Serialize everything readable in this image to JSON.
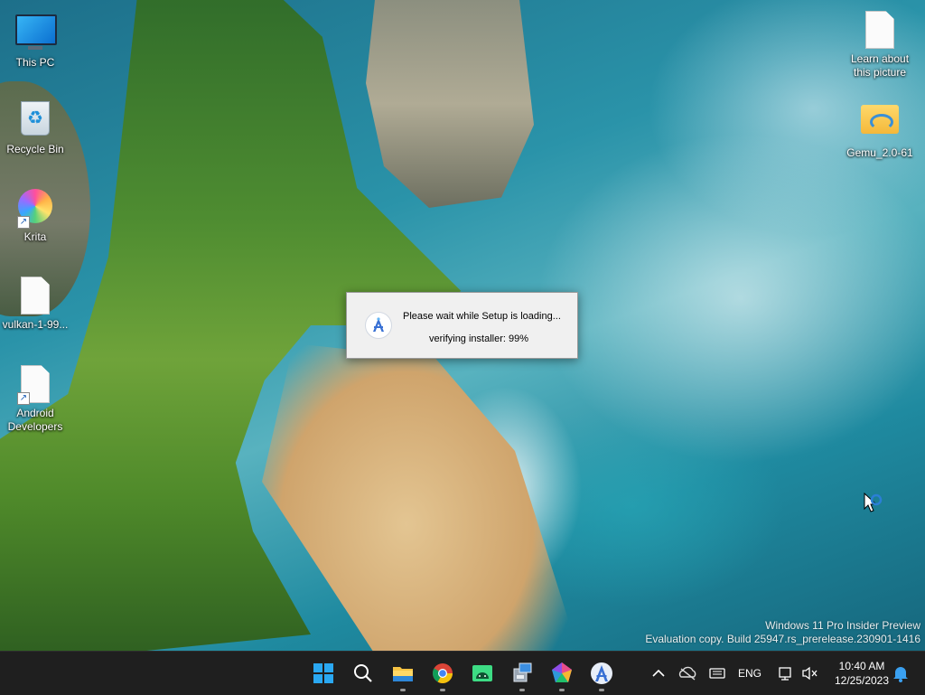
{
  "desktop": {
    "icons_left": [
      {
        "label": "This PC",
        "icon": "this-pc-icon"
      },
      {
        "label": "Recycle Bin",
        "icon": "recycle-bin-icon"
      },
      {
        "label": "Krita",
        "icon": "krita-icon"
      },
      {
        "label": "vulkan-1-99...",
        "icon": "file-icon"
      },
      {
        "label": "Android Developers",
        "icon": "file-shortcut-icon"
      }
    ],
    "icons_right": [
      {
        "label": "Learn about this picture",
        "icon": "file-icon"
      },
      {
        "label": "Gemu_2.0-61",
        "icon": "folder-icon"
      }
    ]
  },
  "dialog": {
    "message": "Please wait while Setup is loading...",
    "status": "verifying installer: 99%",
    "icon": "android-studio-icon"
  },
  "watermark": {
    "line1": "Windows 11 Pro Insider Preview",
    "line2": "Evaluation copy. Build 25947.rs_prerelease.230901-1416"
  },
  "taskbar": {
    "apps": [
      {
        "name": "start",
        "icon": "windows-start-icon"
      },
      {
        "name": "search",
        "icon": "search-icon"
      },
      {
        "name": "file-explorer",
        "icon": "folder-icon"
      },
      {
        "name": "chrome",
        "icon": "chrome-icon"
      },
      {
        "name": "android-studio",
        "icon": "android-icon"
      },
      {
        "name": "setup",
        "icon": "installer-icon"
      },
      {
        "name": "app",
        "icon": "pentagon-app-icon"
      },
      {
        "name": "android-studio-setup",
        "icon": "android-studio-icon"
      }
    ],
    "tray": {
      "language": "ENG",
      "time": "10:40 AM",
      "date": "12/25/2023"
    }
  }
}
